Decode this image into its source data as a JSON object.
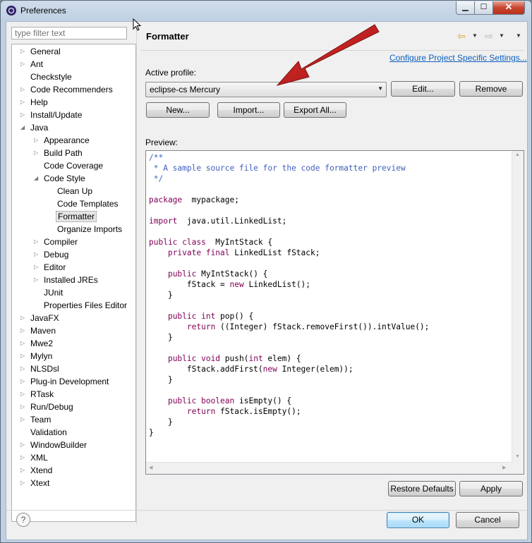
{
  "window": {
    "title": "Preferences"
  },
  "titlebar_buttons": {
    "minimize": "▁",
    "maximize": "☐",
    "close": "✕"
  },
  "filter": {
    "placeholder": "type filter text"
  },
  "tree": [
    {
      "label": "General",
      "level": 0,
      "expander": "collapsed"
    },
    {
      "label": "Ant",
      "level": 0,
      "expander": "collapsed"
    },
    {
      "label": "Checkstyle",
      "level": 0,
      "expander": "none"
    },
    {
      "label": "Code Recommenders",
      "level": 0,
      "expander": "collapsed"
    },
    {
      "label": "Help",
      "level": 0,
      "expander": "collapsed"
    },
    {
      "label": "Install/Update",
      "level": 0,
      "expander": "collapsed"
    },
    {
      "label": "Java",
      "level": 0,
      "expander": "expanded"
    },
    {
      "label": "Appearance",
      "level": 1,
      "expander": "collapsed"
    },
    {
      "label": "Build Path",
      "level": 1,
      "expander": "collapsed"
    },
    {
      "label": "Code Coverage",
      "level": 1,
      "expander": "none"
    },
    {
      "label": "Code Style",
      "level": 1,
      "expander": "expanded"
    },
    {
      "label": "Clean Up",
      "level": 2,
      "expander": "none"
    },
    {
      "label": "Code Templates",
      "level": 2,
      "expander": "none"
    },
    {
      "label": "Formatter",
      "level": 2,
      "expander": "none",
      "selected": true
    },
    {
      "label": "Organize Imports",
      "level": 2,
      "expander": "none"
    },
    {
      "label": "Compiler",
      "level": 1,
      "expander": "collapsed"
    },
    {
      "label": "Debug",
      "level": 1,
      "expander": "collapsed"
    },
    {
      "label": "Editor",
      "level": 1,
      "expander": "collapsed"
    },
    {
      "label": "Installed JREs",
      "level": 1,
      "expander": "collapsed"
    },
    {
      "label": "JUnit",
      "level": 1,
      "expander": "none"
    },
    {
      "label": "Properties Files Editor",
      "level": 1,
      "expander": "none"
    },
    {
      "label": "JavaFX",
      "level": 0,
      "expander": "collapsed"
    },
    {
      "label": "Maven",
      "level": 0,
      "expander": "collapsed"
    },
    {
      "label": "Mwe2",
      "level": 0,
      "expander": "collapsed"
    },
    {
      "label": "Mylyn",
      "level": 0,
      "expander": "collapsed"
    },
    {
      "label": "NLSDsl",
      "level": 0,
      "expander": "collapsed"
    },
    {
      "label": "Plug-in Development",
      "level": 0,
      "expander": "collapsed"
    },
    {
      "label": "RTask",
      "level": 0,
      "expander": "collapsed"
    },
    {
      "label": "Run/Debug",
      "level": 0,
      "expander": "collapsed"
    },
    {
      "label": "Team",
      "level": 0,
      "expander": "collapsed"
    },
    {
      "label": "Validation",
      "level": 0,
      "expander": "none"
    },
    {
      "label": "WindowBuilder",
      "level": 0,
      "expander": "collapsed"
    },
    {
      "label": "XML",
      "level": 0,
      "expander": "collapsed"
    },
    {
      "label": "Xtend",
      "level": 0,
      "expander": "collapsed"
    },
    {
      "label": "Xtext",
      "level": 0,
      "expander": "collapsed"
    }
  ],
  "page": {
    "title": "Formatter",
    "configure_link": "Configure Project Specific Settings...",
    "active_profile_label": "Active profile:",
    "profile_value": "eclipse-cs Mercury",
    "edit_label": "Edit...",
    "remove_label": "Remove",
    "new_label": "New...",
    "import_label": "Import...",
    "export_label": "Export All...",
    "preview_label": "Preview:",
    "restore_label": "Restore Defaults",
    "apply_label": "Apply"
  },
  "preview_code": [
    [
      [
        "cm",
        "/**"
      ]
    ],
    [
      [
        "cm",
        " * A sample source file for the code formatter preview"
      ]
    ],
    [
      [
        "cm",
        " */"
      ]
    ],
    [],
    [
      [
        "kw",
        "package"
      ],
      [
        "",
        "  mypackage;"
      ]
    ],
    [],
    [
      [
        "kw",
        "import"
      ],
      [
        "",
        "  java.util.LinkedList;"
      ]
    ],
    [],
    [
      [
        "kw",
        "public class"
      ],
      [
        "",
        "  MyIntStack {"
      ]
    ],
    [
      [
        "",
        "    "
      ],
      [
        "kw",
        "private final"
      ],
      [
        "",
        " LinkedList fStack;"
      ]
    ],
    [],
    [
      [
        "",
        "    "
      ],
      [
        "kw",
        "public"
      ],
      [
        "",
        " MyIntStack() {"
      ]
    ],
    [
      [
        "",
        "        fStack = "
      ],
      [
        "kw",
        "new"
      ],
      [
        "",
        " LinkedList();"
      ]
    ],
    [
      [
        "",
        "    }"
      ]
    ],
    [],
    [
      [
        "",
        "    "
      ],
      [
        "kw",
        "public int"
      ],
      [
        "",
        " pop() {"
      ]
    ],
    [
      [
        "",
        "        "
      ],
      [
        "kw",
        "return"
      ],
      [
        "",
        " ((Integer) fStack.removeFirst()).intValue();"
      ]
    ],
    [
      [
        "",
        "    }"
      ]
    ],
    [],
    [
      [
        "",
        "    "
      ],
      [
        "kw",
        "public void"
      ],
      [
        "",
        " push("
      ],
      [
        "kw",
        "int"
      ],
      [
        "",
        " elem) {"
      ]
    ],
    [
      [
        "",
        "        fStack.addFirst("
      ],
      [
        "kw",
        "new"
      ],
      [
        "",
        " Integer(elem));"
      ]
    ],
    [
      [
        "",
        "    }"
      ]
    ],
    [],
    [
      [
        "",
        "    "
      ],
      [
        "kw",
        "public boolean"
      ],
      [
        "",
        " isEmpty() {"
      ]
    ],
    [
      [
        "",
        "        "
      ],
      [
        "kw",
        "return"
      ],
      [
        "",
        " fStack.isEmpty();"
      ]
    ],
    [
      [
        "",
        "    }"
      ]
    ],
    [
      [
        "",
        "}"
      ]
    ]
  ],
  "dialog": {
    "help_icon": "?",
    "ok_label": "OK",
    "cancel_label": "Cancel"
  },
  "colors": {
    "keyword": "#7f0055",
    "comment": "#3f5fbf",
    "link": "#0b5fbf",
    "annotation_arrow": "#cc1111"
  }
}
